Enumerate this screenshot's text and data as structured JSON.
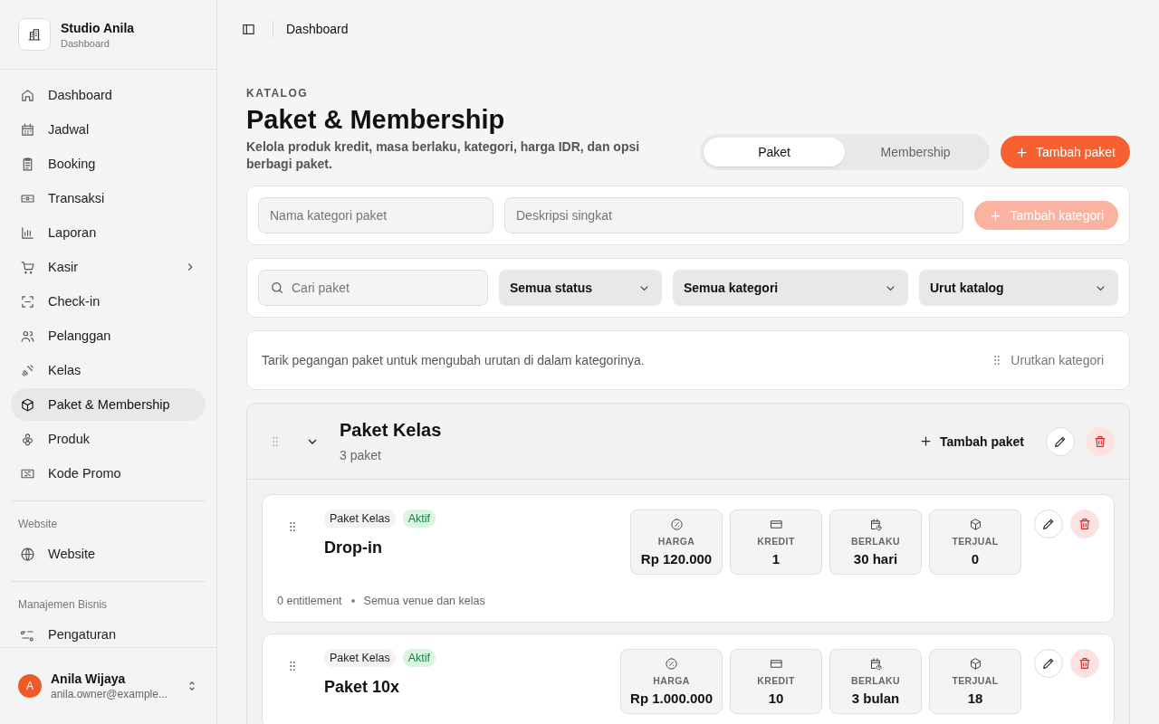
{
  "brand": {
    "name": "Studio Anila",
    "subtitle": "Dashboard"
  },
  "nav": [
    {
      "items": [
        {
          "label": "Dashboard",
          "selected": false
        },
        {
          "label": "Jadwal",
          "selected": false
        },
        {
          "label": "Booking",
          "selected": false
        },
        {
          "label": "Transaksi",
          "selected": false
        },
        {
          "label": "Laporan",
          "selected": false
        },
        {
          "label": "Kasir",
          "selected": false,
          "submenu": true
        },
        {
          "label": "Check-in",
          "selected": false
        },
        {
          "label": "Pelanggan",
          "selected": false
        },
        {
          "label": "Kelas",
          "selected": false
        },
        {
          "label": "Paket & Membership",
          "selected": true
        },
        {
          "label": "Produk",
          "selected": false
        },
        {
          "label": "Kode Promo",
          "selected": false
        }
      ]
    },
    {
      "heading": "Website",
      "items": [
        {
          "label": "Website",
          "selected": false
        }
      ]
    },
    {
      "heading": "Manajemen Bisnis",
      "items": [
        {
          "label": "Pengaturan",
          "selected": false
        }
      ]
    }
  ],
  "user": {
    "initial": "A",
    "name": "Anila Wijaya",
    "email": "anila.owner@example..."
  },
  "topbar": {
    "breadcrumb": "Dashboard"
  },
  "header": {
    "eyebrow": "KATALOG",
    "title": "Paket & Membership",
    "description": "Kelola produk kredit, masa berlaku, kategori, harga IDR, dan opsi berbagi paket."
  },
  "segments": [
    {
      "label": "Paket",
      "selected": true
    },
    {
      "label": "Membership",
      "selected": false
    }
  ],
  "add_button": "Tambah paket",
  "category_form": {
    "name_placeholder": "Nama kategori paket",
    "description_placeholder": "Deskripsi singkat",
    "button": "Tambah kategori",
    "disabled": true
  },
  "filters": {
    "search_placeholder": "Cari paket",
    "selects": [
      "Semua status",
      "Semua kategori",
      "Urut katalog"
    ]
  },
  "hint": {
    "text": "Tarik pegangan paket untuk mengubah urutan di dalam kategorinya.",
    "button": "Urutkan kategori"
  },
  "category": {
    "name": "Paket Kelas",
    "count": "3 paket",
    "add_button": "Tambah paket",
    "expanded": true,
    "packages": [
      {
        "tags": [
          {
            "label": "Paket Kelas",
            "kind": "category"
          },
          {
            "label": "Aktif",
            "kind": "status"
          }
        ],
        "name": "Drop-in",
        "stats": [
          {
            "label": "HARGA",
            "value": "Rp 120.000"
          },
          {
            "label": "KREDIT",
            "value": "1"
          },
          {
            "label": "BERLAKU",
            "value": "30 hari"
          },
          {
            "label": "TERJUAL",
            "value": "0"
          }
        ],
        "meta": [
          "0 entitlement",
          "Semua venue dan kelas"
        ]
      },
      {
        "tags": [
          {
            "label": "Paket Kelas",
            "kind": "category"
          },
          {
            "label": "Aktif",
            "kind": "status"
          }
        ],
        "name": "Paket 10x",
        "stats": [
          {
            "label": "HARGA",
            "value": "Rp 1.000.000"
          },
          {
            "label": "KREDIT",
            "value": "10"
          },
          {
            "label": "BERLAKU",
            "value": "3 bulan"
          },
          {
            "label": "TERJUAL",
            "value": "18"
          }
        ]
      }
    ]
  }
}
